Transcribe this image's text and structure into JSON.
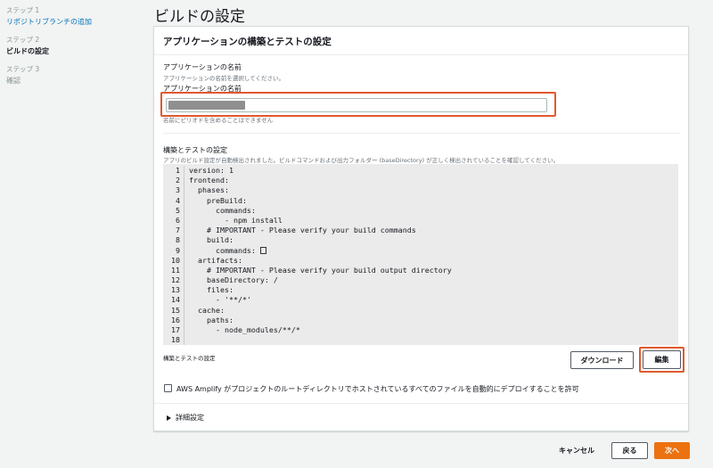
{
  "steps": [
    {
      "num": "ステップ 1",
      "title": "リポジトリブランチの追加",
      "state": "link"
    },
    {
      "num": "ステップ 2",
      "title": "ビルドの設定",
      "state": "current"
    },
    {
      "num": "ステップ 3",
      "title": "確認",
      "state": "dim"
    }
  ],
  "page_title": "ビルドの設定",
  "panel": {
    "header": "アプリケーションの構築とテストの設定",
    "app_name": {
      "label": "アプリケーションの名前",
      "description": "アプリケーションの名前を選択してください。",
      "field_label": "アプリケーションの名前",
      "hint": "名前にピリオドを含めることはできません"
    },
    "build_settings": {
      "label": "構築とテストの設定",
      "description": "アプリのビルド設定が自動検出されました。ビルドコマンドおよび出力フォルダー (baseDirectory) が正しく検出されていることを確認してください。",
      "code_lines": [
        "version: 1",
        "frontend:",
        "  phases:",
        "    preBuild:",
        "      commands:",
        "        - npm install",
        "    # IMPORTANT - Please verify your build commands",
        "    build:",
        "      commands: ",
        "  artifacts:",
        "    # IMPORTANT - Please verify your build output directory",
        "    baseDirectory: /",
        "    files:",
        "      - '**/*'",
        "  cache:",
        "    paths:",
        "      - node_modules/**/*",
        ""
      ],
      "caption": "構築とテストの設定",
      "download_label": "ダウンロード",
      "edit_label": "編集"
    },
    "checkbox_label": "AWS Amplify がプロジェクトのルートディレクトリでホストされているすべてのファイルを自動的にデプロイすることを許可",
    "advanced_label": "詳細設定"
  },
  "footer": {
    "cancel_label": "キャンセル",
    "back_label": "戻る",
    "next_label": "次へ"
  },
  "colors": {
    "accent_orange": "#ec7211",
    "link_blue": "#0073bb",
    "highlight_red": "#e0592e"
  }
}
